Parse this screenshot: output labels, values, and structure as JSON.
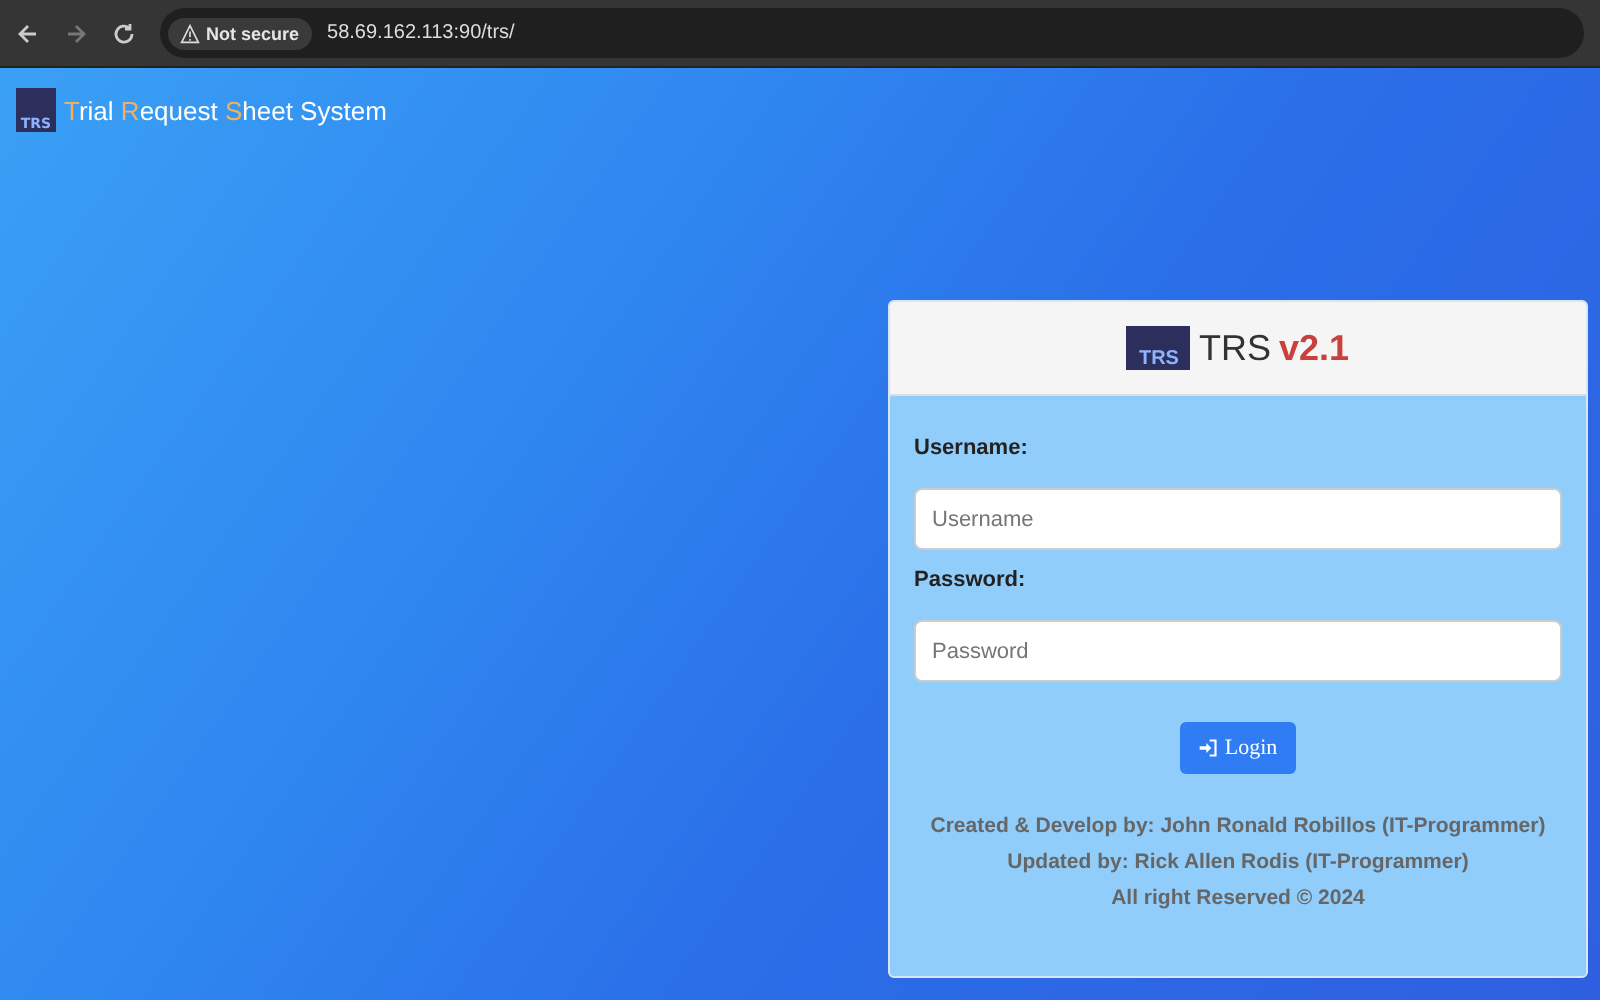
{
  "browser": {
    "security_label": "Not secure",
    "url": "58.69.162.113:90/trs/"
  },
  "brand": {
    "logo_text": "TRS",
    "title_parts": [
      {
        "text": "T",
        "accent": true
      },
      {
        "text": "rial ",
        "accent": false
      },
      {
        "text": "R",
        "accent": true
      },
      {
        "text": "equest ",
        "accent": false
      },
      {
        "text": "S",
        "accent": true
      },
      {
        "text": "heet System",
        "accent": false
      }
    ]
  },
  "login": {
    "logo_text": "TRS",
    "title": "TRS",
    "version": "v2.1",
    "fields": [
      {
        "label": "Username:",
        "placeholder": "Username"
      },
      {
        "label": "Password:",
        "placeholder": "Password"
      }
    ],
    "button": "Login",
    "credits": [
      "Created & Develop by: John Ronald Robillos (IT-Programmer)",
      "Updated by: Rick Allen Rodis (IT-Programmer)",
      "All right Reserved © 2024"
    ]
  }
}
